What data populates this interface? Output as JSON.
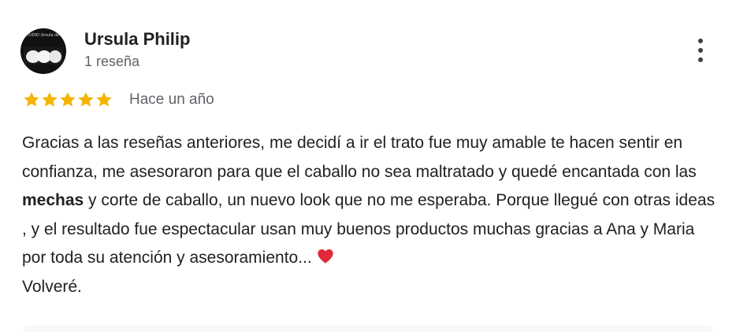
{
  "review": {
    "author_name": "Ursula Philip",
    "review_count": "1 reseña",
    "rating": 5,
    "rating_max": 5,
    "date": "Hace un año",
    "text_part1": "Gracias a las reseñas anteriores, me decidí a ir el trato fue muy amable te hacen sentir en confianza, me asesoraron para que el caballo no sea maltratado y quedé encantada con las ",
    "text_bold": "mechas",
    "text_part2": " y corte de caballo, un nuevo look que no me esperaba. Porque llegué con otras ideas , y el resultado fue espectacular usan muy buenos productos muchas gracias a Ana y Maria por toda su atención y asesoramiento... ",
    "text_last_line": "Volveré.",
    "avatar_text": "TUDIO Ursula de Phili",
    "heart_icon": "red-heart-emoji",
    "more_icon": "more-vertical-icon",
    "star_color": "#f4b400",
    "heart_color": "#e0283a"
  }
}
